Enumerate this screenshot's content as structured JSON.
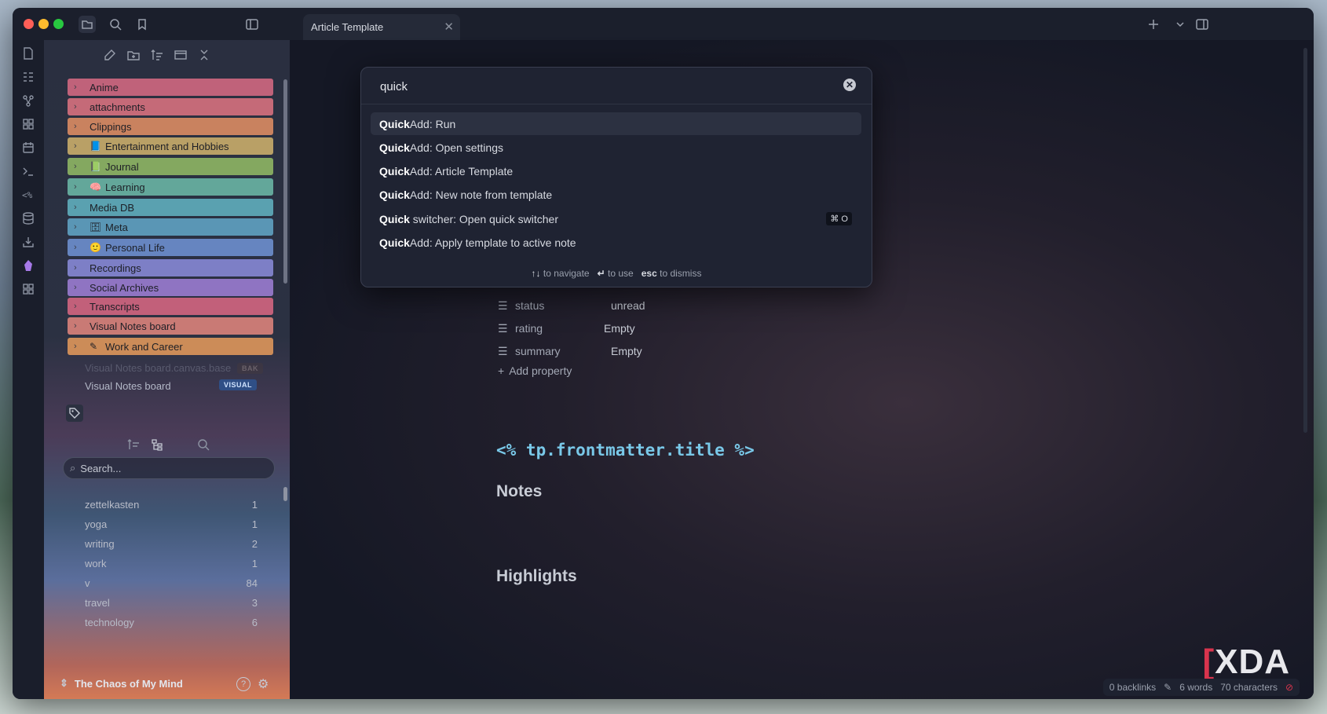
{
  "tab": {
    "title": "Article Template"
  },
  "folders": [
    {
      "label": "Anime",
      "color": "#c0627a"
    },
    {
      "label": "attachments",
      "color": "#c56a78"
    },
    {
      "label": "Clippings",
      "color": "#c9825f"
    },
    {
      "label": "Entertainment and Hobbies",
      "color": "#b9a066"
    },
    {
      "label": "Journal",
      "color": "#84a860"
    },
    {
      "label": "Learning",
      "color": "#63a79a"
    },
    {
      "label": "Media DB",
      "color": "#5aa1b0"
    },
    {
      "label": "Meta",
      "color": "#5a96b5"
    },
    {
      "label": "Personal Life",
      "color": "#6685c0"
    },
    {
      "label": "Recordings",
      "color": "#7d7fc6"
    },
    {
      "label": "Social Archives",
      "color": "#8f74c2"
    },
    {
      "label": "Transcripts",
      "color": "#c2607a"
    },
    {
      "label": "Visual Notes board",
      "color": "#c97a75"
    },
    {
      "label": "Work and Career",
      "color": "#cc8c58"
    }
  ],
  "files": [
    {
      "label": "Visual Notes board.canvas.base",
      "badge": "BAK"
    },
    {
      "label": "Visual Notes board",
      "badge": "VISUAL"
    }
  ],
  "tags": {
    "search_placeholder": "Search...",
    "items": [
      {
        "name": "zettelkasten",
        "count": "1"
      },
      {
        "name": "yoga",
        "count": "1"
      },
      {
        "name": "writing",
        "count": "2"
      },
      {
        "name": "work",
        "count": "1"
      },
      {
        "name": "v",
        "count": "84"
      },
      {
        "name": "travel",
        "count": "3"
      },
      {
        "name": "technology",
        "count": "6"
      }
    ]
  },
  "vault": {
    "name": "The Chaos of My Mind"
  },
  "palette": {
    "query": "quick",
    "suggestions": [
      {
        "match": "Quick",
        "rest": "Add: Run",
        "selected": true,
        "hotkey": ""
      },
      {
        "match": "Quick",
        "rest": "Add: Open settings",
        "selected": false,
        "hotkey": ""
      },
      {
        "match": "Quick",
        "rest": "Add: Article Template",
        "selected": false,
        "hotkey": ""
      },
      {
        "match": "Quick",
        "rest": "Add: New note from template",
        "selected": false,
        "hotkey": ""
      },
      {
        "match": "Quick",
        "rest": " switcher: Open quick switcher",
        "selected": false,
        "hotkey": "⌘ O"
      },
      {
        "match": "Quick",
        "rest": "Add: Apply template to active note",
        "selected": false,
        "hotkey": ""
      }
    ],
    "hints": {
      "nav_key": "↑↓",
      "nav_text": "to navigate",
      "use_key": "↵",
      "use_text": "to use",
      "esc_key": "esc",
      "esc_text": "to dismiss"
    }
  },
  "properties": [
    {
      "name": "status",
      "value": "unread"
    },
    {
      "name": "rating",
      "value": "Empty"
    },
    {
      "name": "summary",
      "value": "Empty"
    }
  ],
  "add_property": "Add property",
  "editor": {
    "title_code": "<% tp.frontmatter.title %>",
    "heading_notes": "Notes",
    "heading_highlights": "Highlights"
  },
  "statusbar": {
    "backlinks": "0 backlinks",
    "words": "6 words",
    "chars": "70 characters"
  },
  "watermark": "XDA"
}
